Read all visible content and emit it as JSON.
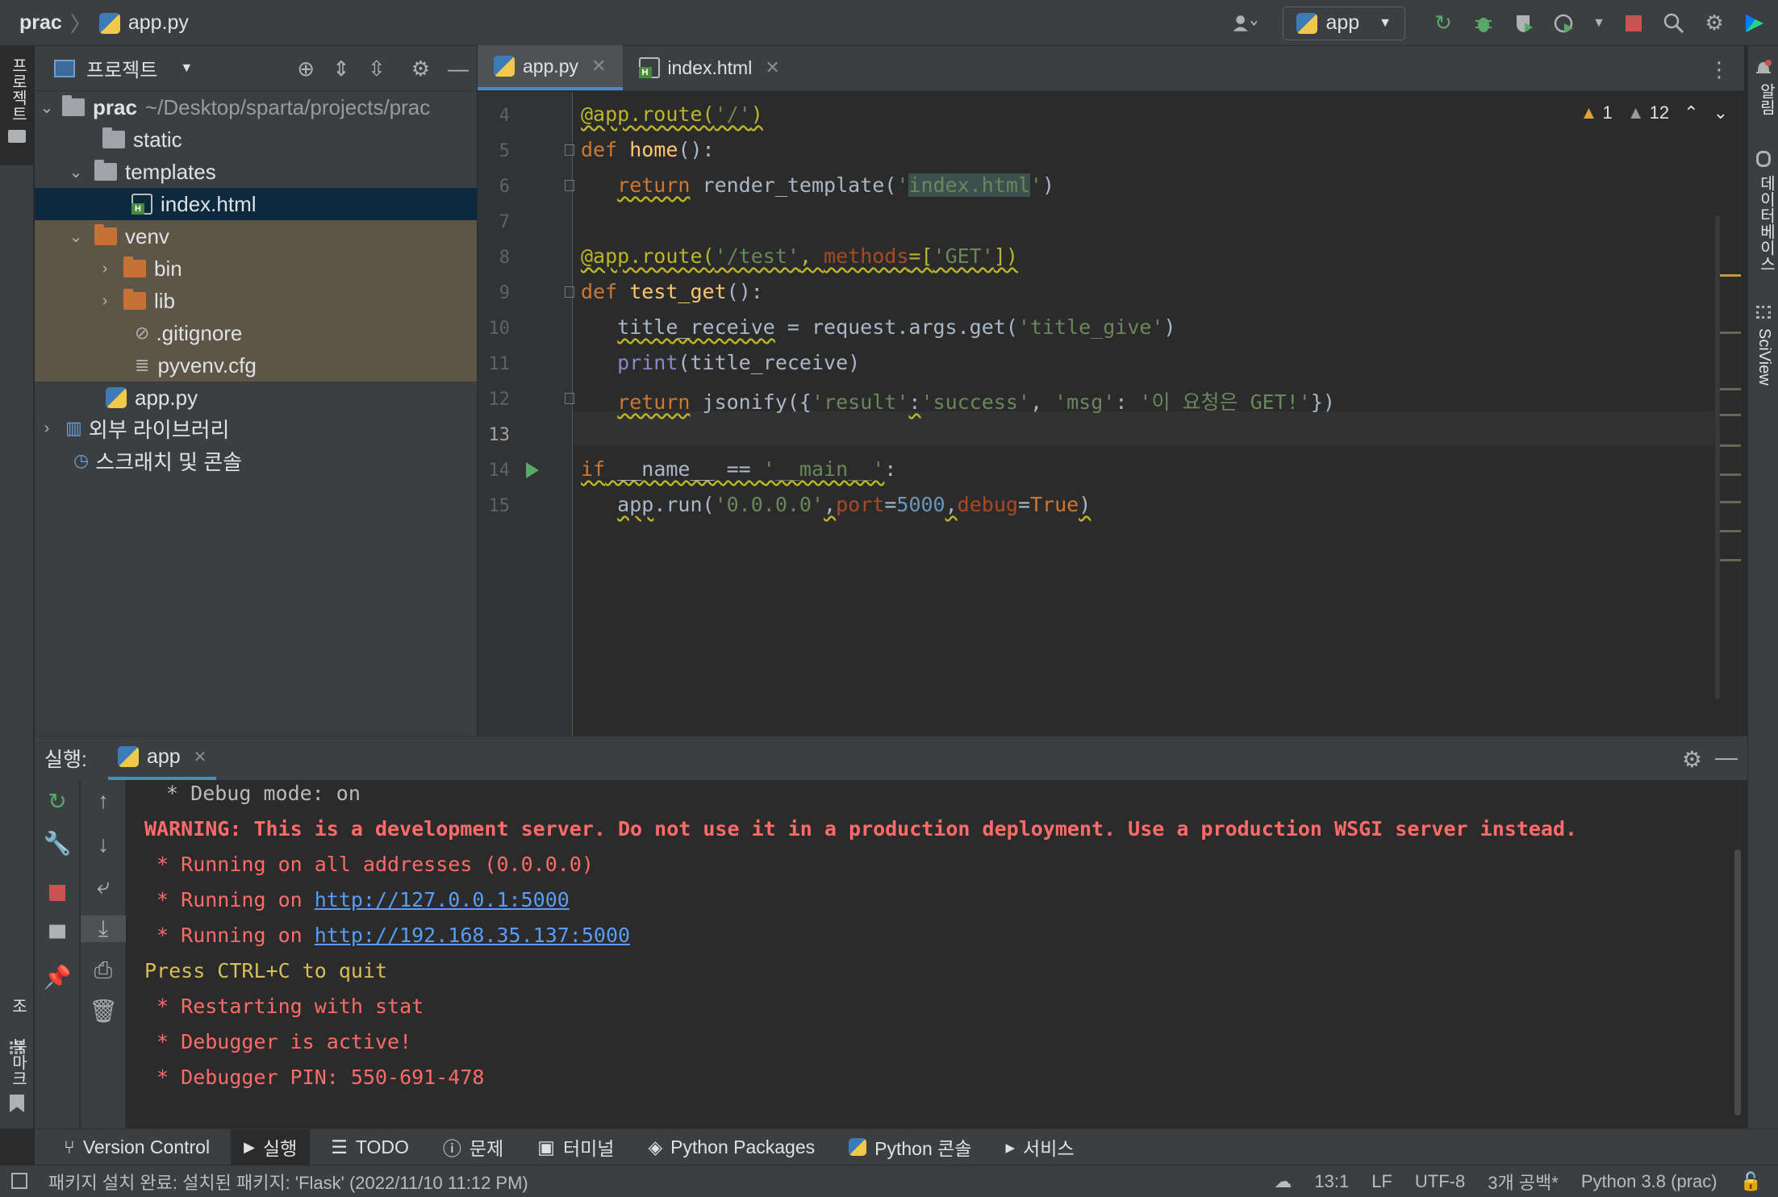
{
  "titlebar": {
    "project": "prac",
    "file": "app.py",
    "run_config": "app"
  },
  "left_strip": {
    "project_label": "프로젝트",
    "structure_label": "구조",
    "bookmarks_label": "북마크"
  },
  "right_strip": {
    "notifications_label": "알림",
    "database_label": "데이터베이스",
    "sciview_label": "SciView"
  },
  "project_panel": {
    "title": "프로젝트",
    "tree": [
      {
        "label": "prac",
        "path": "~/Desktop/sparta/projects/prac"
      },
      {
        "label": "static"
      },
      {
        "label": "templates"
      },
      {
        "label": "index.html"
      },
      {
        "label": "venv"
      },
      {
        "label": "bin"
      },
      {
        "label": "lib"
      },
      {
        "label": ".gitignore"
      },
      {
        "label": "pyvenv.cfg"
      },
      {
        "label": "app.py"
      },
      {
        "label": "외부 라이브러리"
      },
      {
        "label": "스크래치 및 콘솔"
      }
    ]
  },
  "editor": {
    "tabs": [
      {
        "label": "app.py",
        "active": true
      },
      {
        "label": "index.html",
        "active": false
      }
    ],
    "warnings": {
      "warn_count": "1",
      "weak_count": "12"
    },
    "line_numbers": [
      "4",
      "5",
      "6",
      "7",
      "8",
      "9",
      "10",
      "11",
      "12",
      "13",
      "14",
      "15"
    ]
  },
  "run_panel": {
    "label": "실행:",
    "tab": "app",
    "output": [
      " * Debug mode: on",
      "WARNING: This is a development server. Do not use it in a production deployment. Use a production WSGI server instead.",
      " * Running on all addresses (0.0.0.0)",
      " * Running on ",
      "http://127.0.0.1:5000",
      " * Running on ",
      "http://192.168.35.137:5000",
      "Press CTRL+C to quit",
      " * Restarting with stat",
      " * Debugger is active!",
      " * Debugger PIN: 550-691-478"
    ]
  },
  "bottom_tabs": [
    "Version Control",
    "실행",
    "TODO",
    "문제",
    "터미널",
    "Python Packages",
    "Python 콘솔",
    "서비스"
  ],
  "statusbar": {
    "message": "패키지 설치 완료: 설치된 패키지: 'Flask' (2022/11/10 11:12 PM)",
    "position": "13:1",
    "line_sep": "LF",
    "encoding": "UTF-8",
    "indent": "3개 공백*",
    "interpreter": "Python 3.8 (prac)"
  },
  "colors": {
    "accent": "#4a88c7",
    "error": "#ff6b68",
    "link": "#589df6",
    "selection": "#0d293e",
    "excluded": "#5d5545"
  }
}
